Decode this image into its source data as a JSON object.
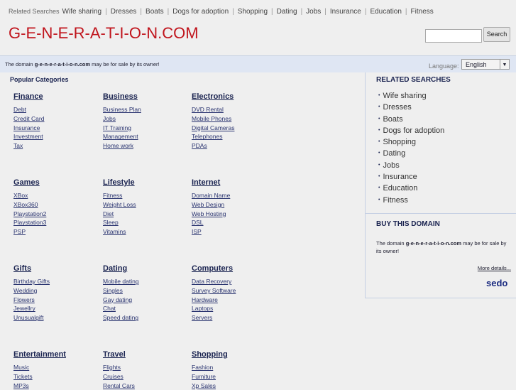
{
  "top_nav": {
    "label": "Related Searches",
    "items": [
      "Wife sharing",
      "Dresses",
      "Boats",
      "Dogs for adoption",
      "Shopping",
      "Dating",
      "Jobs",
      "Insurance",
      "Education",
      "Fitness"
    ]
  },
  "logo": "G-E-N-E-R-A-T-I-O-N.COM",
  "search": {
    "button": "Search",
    "value": ""
  },
  "banner": {
    "pre": "The domain ",
    "domain": "g-e-n-e-r-a-t-i-o-n.com",
    "post": " may be for sale by its owner!",
    "language_label": "Language:",
    "language": "English"
  },
  "popular_title": "Popular Categories",
  "categories": [
    {
      "title": "Finance",
      "links": [
        "Debt",
        "Credit Card",
        "Insurance",
        "Investment",
        "Tax"
      ]
    },
    {
      "title": "Business",
      "links": [
        "Business Plan",
        "Jobs",
        "IT Training",
        "Management",
        "Home work"
      ]
    },
    {
      "title": "Electronics",
      "links": [
        "DVD Rental",
        "Mobile Phones",
        "Digital Cameras",
        "Telephones",
        "PDAs"
      ]
    },
    {
      "title": "Games",
      "links": [
        "XBox",
        "XBox360",
        "Playstation2",
        "Playstation3",
        "PSP"
      ]
    },
    {
      "title": "Lifestyle",
      "links": [
        "Fitness",
        "Weight Loss",
        "Diet",
        "Sleep",
        "Vitamins"
      ]
    },
    {
      "title": "Internet",
      "links": [
        "Domain Name",
        "Web Design",
        "Web Hosting",
        "DSL",
        "ISP"
      ]
    },
    {
      "title": "Gifts",
      "links": [
        "Birthday Gifts",
        "Wedding",
        "Flowers",
        "Jewellry",
        "Unusualgift"
      ]
    },
    {
      "title": "Dating",
      "links": [
        "Mobile dating",
        "Singles",
        "Gay dating",
        "Chat",
        "Speed dating"
      ]
    },
    {
      "title": "Computers",
      "links": [
        "Data Recovery",
        "Survey Software",
        "Hardware",
        "Laptops",
        "Servers"
      ]
    },
    {
      "title": "Entertainment",
      "links": [
        "Music",
        "Tickets",
        "MP3s"
      ]
    },
    {
      "title": "Travel",
      "links": [
        "Flights",
        "Cruises",
        "Rental Cars"
      ]
    },
    {
      "title": "Shopping",
      "links": [
        "Fashion",
        "Furniture",
        "Xp Sales"
      ]
    }
  ],
  "sidebar": {
    "related_title": "RELATED SEARCHES",
    "related": [
      "Wife sharing",
      "Dresses",
      "Boats",
      "Dogs for adoption",
      "Shopping",
      "Dating",
      "Jobs",
      "Insurance",
      "Education",
      "Fitness"
    ],
    "buy_title": "BUY THIS DOMAIN",
    "buy_pre": "The domain ",
    "buy_domain": "g-e-n-e-r-a-t-i-o-n.com",
    "buy_post": " may be for sale by its owner!",
    "more": "More details...",
    "brand": "sedo"
  }
}
